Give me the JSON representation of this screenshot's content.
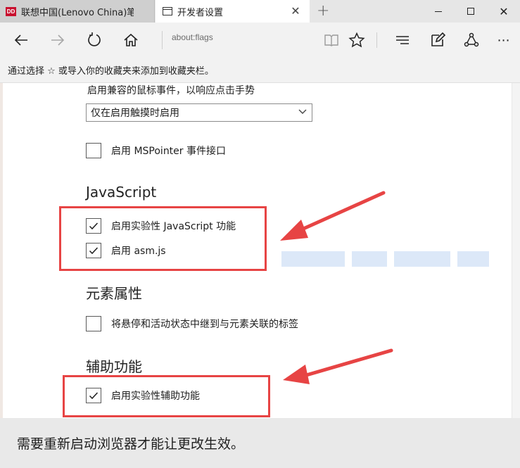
{
  "tabs": [
    {
      "title": "联想中国(Lenovo China)笔记",
      "favicon": "lenovo-favicon",
      "favicon_text": "DD"
    },
    {
      "title": "开发者设置",
      "favicon": "page-icon"
    }
  ],
  "tab_close_glyph": "✕",
  "new_tab_glyph": "+",
  "window_controls": {
    "close_glyph": "✕"
  },
  "address_bar": {
    "url": "about:flags"
  },
  "nav": {
    "more_glyph": "⋯"
  },
  "favorites_bar": {
    "text": "通过选择 ☆ 或导入你的收藏夹来添加到收藏夹栏。"
  },
  "touch_events": {
    "label": "启用兼容的鼠标事件，以响应点击手势",
    "selected": "仅在启用触摸时启用"
  },
  "mspointer": {
    "label": "启用 MSPointer 事件接口",
    "checked": false
  },
  "sections": {
    "javascript": {
      "title": "JavaScript",
      "items": [
        {
          "label": "启用实验性 JavaScript 功能",
          "checked": true
        },
        {
          "label": "启用 asm.js",
          "checked": true
        }
      ]
    },
    "element_properties": {
      "title": "元素属性",
      "items": [
        {
          "label": "将悬停和活动状态中继到与元素关联的标签",
          "checked": false
        }
      ]
    },
    "accessibility": {
      "title": "辅助功能",
      "items": [
        {
          "label": "启用实验性辅助功能",
          "checked": true
        }
      ]
    }
  },
  "restart_notice": "需要重新启动浏览器才能让更改生效。",
  "colors": {
    "highlight": "#e74444",
    "footer_bg": "#e9e9e9"
  }
}
